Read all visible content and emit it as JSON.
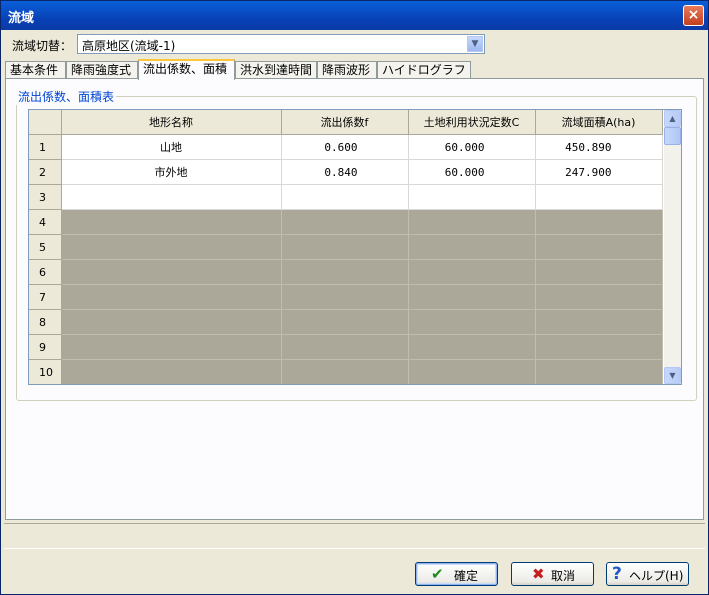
{
  "window": {
    "title": "流域",
    "close_icon": "×"
  },
  "selector": {
    "label": "流域切替：",
    "value": "高原地区(流域-1)"
  },
  "tabs": [
    {
      "label": "基本条件"
    },
    {
      "label": "降雨強度式"
    },
    {
      "label": "流出係数、面積"
    },
    {
      "label": "洪水到達時間"
    },
    {
      "label": "降雨波形"
    },
    {
      "label": "ハイドログラフ"
    }
  ],
  "active_tab": 2,
  "group": {
    "title": "流出係数、面積表"
  },
  "table": {
    "headers": [
      "地形名称",
      "流出係数f",
      "土地利用状況定数C",
      "流域面積A(ha)"
    ],
    "rows": [
      {
        "no": "1",
        "name": "山地",
        "f": "0.600",
        "c": "60.000",
        "a": "450.890"
      },
      {
        "no": "2",
        "name": "市外地",
        "f": "0.840",
        "c": "60.000",
        "a": "247.900"
      },
      {
        "no": "3",
        "name": "",
        "f": "",
        "c": "",
        "a": ""
      },
      {
        "no": "4",
        "name": "",
        "f": "",
        "c": "",
        "a": ""
      },
      {
        "no": "5",
        "name": "",
        "f": "",
        "c": "",
        "a": ""
      },
      {
        "no": "6",
        "name": "",
        "f": "",
        "c": "",
        "a": ""
      },
      {
        "no": "7",
        "name": "",
        "f": "",
        "c": "",
        "a": ""
      },
      {
        "no": "8",
        "name": "",
        "f": "",
        "c": "",
        "a": ""
      },
      {
        "no": "9",
        "name": "",
        "f": "",
        "c": "",
        "a": ""
      },
      {
        "no": "10",
        "name": "",
        "f": "",
        "c": "",
        "a": ""
      }
    ],
    "disabled_from_row": 4
  },
  "buttons": {
    "ok": "確定",
    "cancel": "取消",
    "help": "ヘルプ(H)"
  },
  "icons": {
    "ok": "checkmark-icon",
    "cancel": "x-mark-icon",
    "help": "question-icon"
  },
  "colors": {
    "accent": "#0a5fd8",
    "disabled_cell": "#aca899",
    "group_title": "#0046d5",
    "tab_highlight": "#ffc83c"
  }
}
